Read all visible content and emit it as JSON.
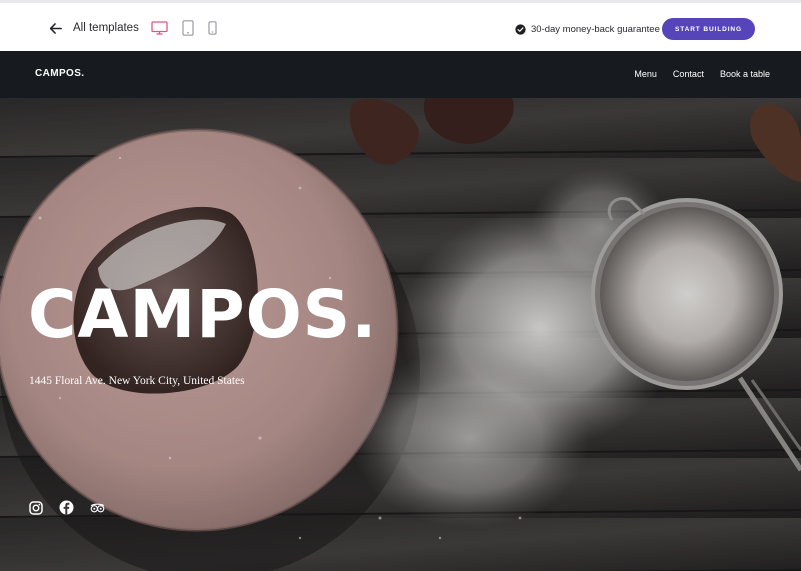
{
  "topbar": {
    "back_label": "All templates",
    "devices": [
      "desktop-icon",
      "tablet-icon",
      "mobile-icon"
    ],
    "active_device": "desktop",
    "guarantee_text": "30-day money-back guarantee",
    "start_button": "START BUILDING"
  },
  "site": {
    "logo": "CAMPOS.",
    "nav": [
      {
        "label": "Menu"
      },
      {
        "label": "Contact"
      },
      {
        "label": "Book a table"
      }
    ],
    "hero": {
      "title": "CAMPOS.",
      "address": "1445 Floral Ave. New York City, United States"
    },
    "socials": [
      "instagram-icon",
      "facebook-icon",
      "tripadvisor-icon"
    ]
  },
  "colors": {
    "accent": "#5545b8",
    "device_active": "#e0567a",
    "nav_bg": "#171b1f",
    "hero_text": "#ffffff"
  }
}
